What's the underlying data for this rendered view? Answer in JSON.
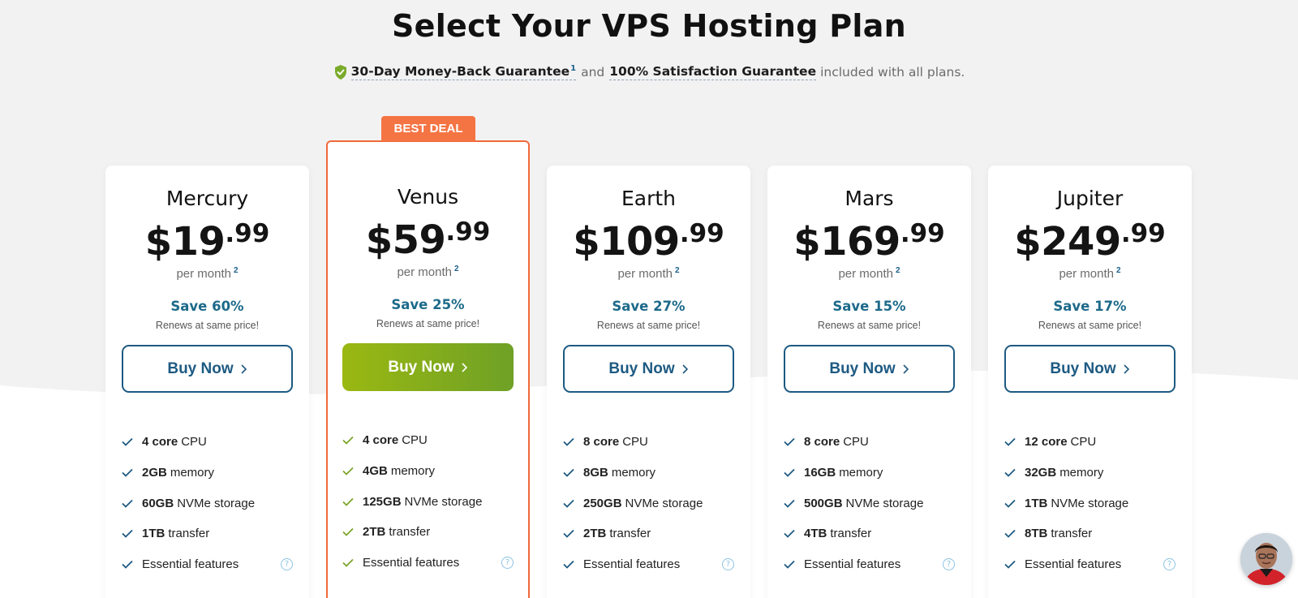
{
  "header": {
    "title": "Select Your VPS Hosting Plan",
    "guarantee_money_back": "30-Day Money-Back Guarantee",
    "guarantee_money_back_sup": "1",
    "guarantee_and": "and",
    "guarantee_satisfaction": "100% Satisfaction Guarantee",
    "guarantee_tail": "included with all plans."
  },
  "badge": {
    "label": "BEST DEAL"
  },
  "colors": {
    "accent_blue": "#1d5a82",
    "badge_orange": "#f47443",
    "featured_border": "#f0693a",
    "featured_button_green": "#8bb11a",
    "check_blue": "#1d5a82",
    "check_green": "#7aa52a"
  },
  "plans": [
    {
      "name": "Mercury",
      "price_dollars": "$19",
      "price_cents": ".99",
      "per_month": "per month",
      "per_month_sup": "2",
      "save": "Save 60%",
      "renews": "Renews at same price!",
      "button": "Buy Now",
      "featured": false,
      "features": [
        {
          "bold": "4 core",
          "text": "CPU"
        },
        {
          "bold": "2GB",
          "text": "memory"
        },
        {
          "bold": "60GB",
          "text": "NVMe storage"
        },
        {
          "bold": "1TB",
          "text": "transfer"
        },
        {
          "bold": "",
          "text": "Essential features",
          "help": "?"
        }
      ]
    },
    {
      "name": "Venus",
      "price_dollars": "$59",
      "price_cents": ".99",
      "per_month": "per month",
      "per_month_sup": "2",
      "save": "Save 25%",
      "renews": "Renews at same price!",
      "button": "Buy Now",
      "featured": true,
      "features": [
        {
          "bold": "4 core",
          "text": "CPU"
        },
        {
          "bold": "4GB",
          "text": "memory"
        },
        {
          "bold": "125GB",
          "text": "NVMe storage"
        },
        {
          "bold": "2TB",
          "text": "transfer"
        },
        {
          "bold": "",
          "text": "Essential features",
          "help": "?"
        }
      ]
    },
    {
      "name": "Earth",
      "price_dollars": "$109",
      "price_cents": ".99",
      "per_month": "per month",
      "per_month_sup": "2",
      "save": "Save 27%",
      "renews": "Renews at same price!",
      "button": "Buy Now",
      "featured": false,
      "features": [
        {
          "bold": "8 core",
          "text": "CPU"
        },
        {
          "bold": "8GB",
          "text": "memory"
        },
        {
          "bold": "250GB",
          "text": "NVMe storage"
        },
        {
          "bold": "2TB",
          "text": "transfer"
        },
        {
          "bold": "",
          "text": "Essential features",
          "help": "?"
        }
      ]
    },
    {
      "name": "Mars",
      "price_dollars": "$169",
      "price_cents": ".99",
      "per_month": "per month",
      "per_month_sup": "2",
      "save": "Save 15%",
      "renews": "Renews at same price!",
      "button": "Buy Now",
      "featured": false,
      "features": [
        {
          "bold": "8 core",
          "text": "CPU"
        },
        {
          "bold": "16GB",
          "text": "memory"
        },
        {
          "bold": "500GB",
          "text": "NVMe storage"
        },
        {
          "bold": "4TB",
          "text": "transfer"
        },
        {
          "bold": "",
          "text": "Essential features",
          "help": "?"
        }
      ]
    },
    {
      "name": "Jupiter",
      "price_dollars": "$249",
      "price_cents": ".99",
      "per_month": "per month",
      "per_month_sup": "2",
      "save": "Save 17%",
      "renews": "Renews at same price!",
      "button": "Buy Now",
      "featured": false,
      "features": [
        {
          "bold": "12 core",
          "text": "CPU"
        },
        {
          "bold": "32GB",
          "text": "memory"
        },
        {
          "bold": "1TB",
          "text": "NVMe storage"
        },
        {
          "bold": "8TB",
          "text": "transfer"
        },
        {
          "bold": "",
          "text": "Essential features",
          "help": "?"
        }
      ]
    }
  ]
}
